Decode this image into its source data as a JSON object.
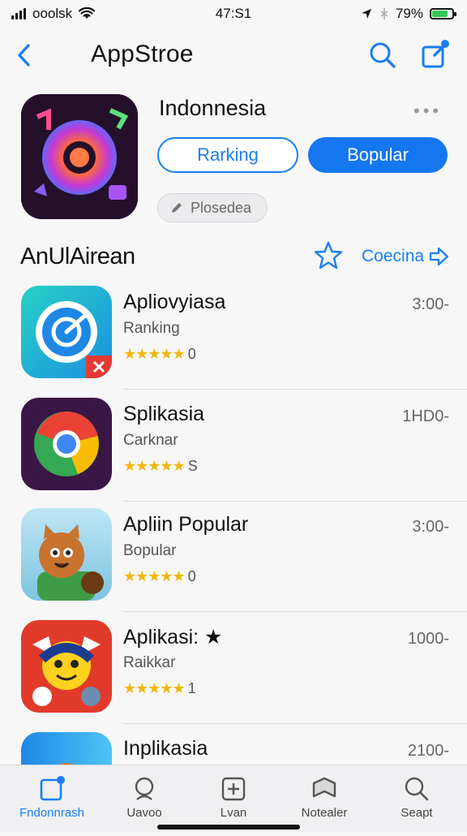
{
  "status": {
    "carrier": "ooolsk",
    "time": "47:S1",
    "battery": "79%",
    "battery_level": 0.79
  },
  "nav": {
    "title": "AppStroe"
  },
  "hero": {
    "title": "Indonnesia",
    "more": "•••",
    "button_outline": "Rarking",
    "button_solid": "Bopular",
    "chip": "Plosedea"
  },
  "section": {
    "title": "AnUlAirean",
    "see_all": "Coecina"
  },
  "apps": [
    {
      "name": "Apliovyiasa",
      "subtitle": "Ranking",
      "stars": "★★★★★",
      "rating_suffix": "0",
      "count": "3:00-"
    },
    {
      "name": "Splikasia",
      "subtitle": "Carknar",
      "stars": "★★★★★",
      "rating_suffix": "S",
      "count": "1HD0-"
    },
    {
      "name": "Apliin Popular",
      "subtitle": "Bopular",
      "stars": "★★★★★",
      "rating_suffix": "0",
      "count": "3:00-"
    },
    {
      "name": "Aplikasi: ★",
      "subtitle": "Raikkar",
      "stars": "★★★★★",
      "rating_suffix": "1",
      "count": "1000-"
    },
    {
      "name": "Inplikasia",
      "subtitle": "",
      "stars": "",
      "rating_suffix": "",
      "count": "2100-"
    }
  ],
  "tabs": [
    {
      "label": "Fndonnrash",
      "icon": "today-icon",
      "active": true
    },
    {
      "label": "Uavoo",
      "icon": "search-icon",
      "active": false
    },
    {
      "label": "Lvan",
      "icon": "add-icon",
      "active": false
    },
    {
      "label": "Notealer",
      "icon": "arcade-icon",
      "active": false
    },
    {
      "label": "Seapt",
      "icon": "search-icon",
      "active": false
    }
  ],
  "colors": {
    "accent": "#1a7ef0",
    "star": "#f2b705",
    "battery": "#34c759"
  }
}
